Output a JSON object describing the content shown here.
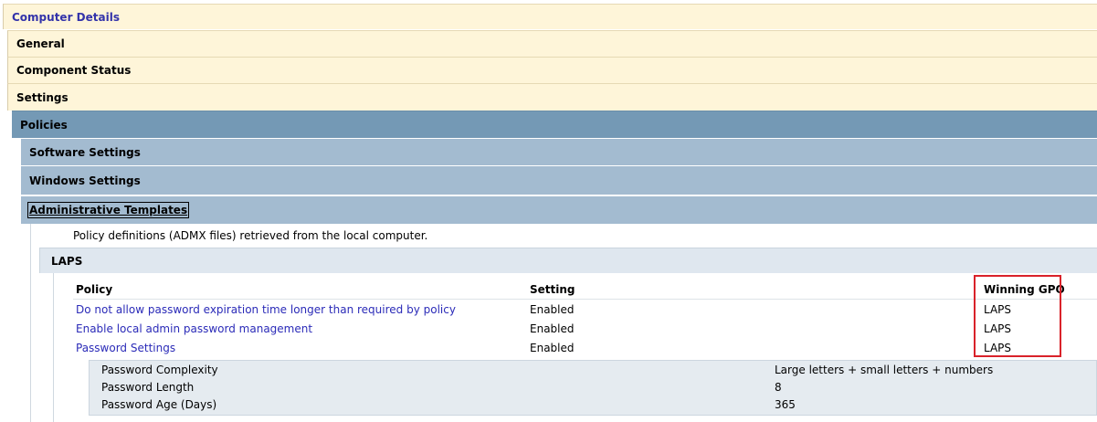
{
  "sections": {
    "computer_details": "Computer Details",
    "general": "General",
    "component_status": "Component Status",
    "settings": "Settings",
    "policies": "Policies",
    "software_settings": "Software Settings",
    "windows_settings": "Windows Settings",
    "administrative_templates": "Administrative Templates"
  },
  "admin_note": "Policy definitions (ADMX files) retrieved from the local computer.",
  "laps": {
    "title": "LAPS",
    "columns": {
      "policy": "Policy",
      "setting": "Setting",
      "winning_gpo": "Winning GPO"
    },
    "rows": [
      {
        "policy": "Do not allow password expiration time longer than required by policy",
        "setting": "Enabled",
        "gpo": "LAPS"
      },
      {
        "policy": "Enable local admin password management",
        "setting": "Enabled",
        "gpo": "LAPS"
      },
      {
        "policy": "Password Settings",
        "setting": "Enabled",
        "gpo": "LAPS"
      }
    ],
    "password_settings": [
      {
        "name": "Password Complexity",
        "value": "Large letters + small letters + numbers"
      },
      {
        "name": "Password Length",
        "value": "8"
      },
      {
        "name": "Password Age (Days)",
        "value": "365"
      }
    ]
  },
  "colors": {
    "beige": "#fef5d9",
    "policies_blue": "#7499b5",
    "sub_blue": "#a3bbd0",
    "laps_light": "#dfe7ef",
    "link": "#2b2bb8",
    "highlight_red": "#d9222a"
  }
}
